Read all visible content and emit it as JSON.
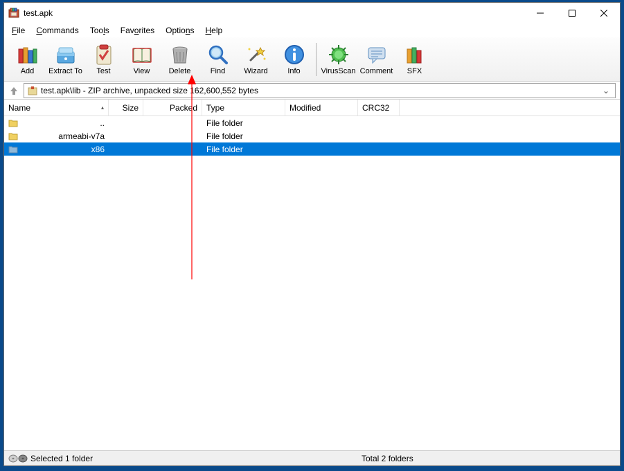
{
  "title": "test.apk",
  "menubar": [
    "File",
    "Commands",
    "Tools",
    "Favorites",
    "Options",
    "Help"
  ],
  "toolbar": {
    "add": "Add",
    "extract": "Extract To",
    "test": "Test",
    "view": "View",
    "delete": "Delete",
    "find": "Find",
    "wizard": "Wizard",
    "info": "Info",
    "virusscan": "VirusScan",
    "comment": "Comment",
    "sfx": "SFX"
  },
  "path": "test.apk\\lib - ZIP archive, unpacked size 162,600,552 bytes",
  "columns": {
    "name": "Name",
    "size": "Size",
    "packed": "Packed",
    "type": "Type",
    "modified": "Modified",
    "crc32": "CRC32"
  },
  "rows": [
    {
      "name": "..",
      "type": "File folder",
      "selected": false,
      "kind": "up"
    },
    {
      "name": "armeabi-v7a",
      "type": "File folder",
      "selected": false,
      "kind": "folder"
    },
    {
      "name": "x86",
      "type": "File folder",
      "selected": true,
      "kind": "folder"
    }
  ],
  "status": {
    "left": "Selected 1 folder",
    "right": "Total 2 folders"
  }
}
